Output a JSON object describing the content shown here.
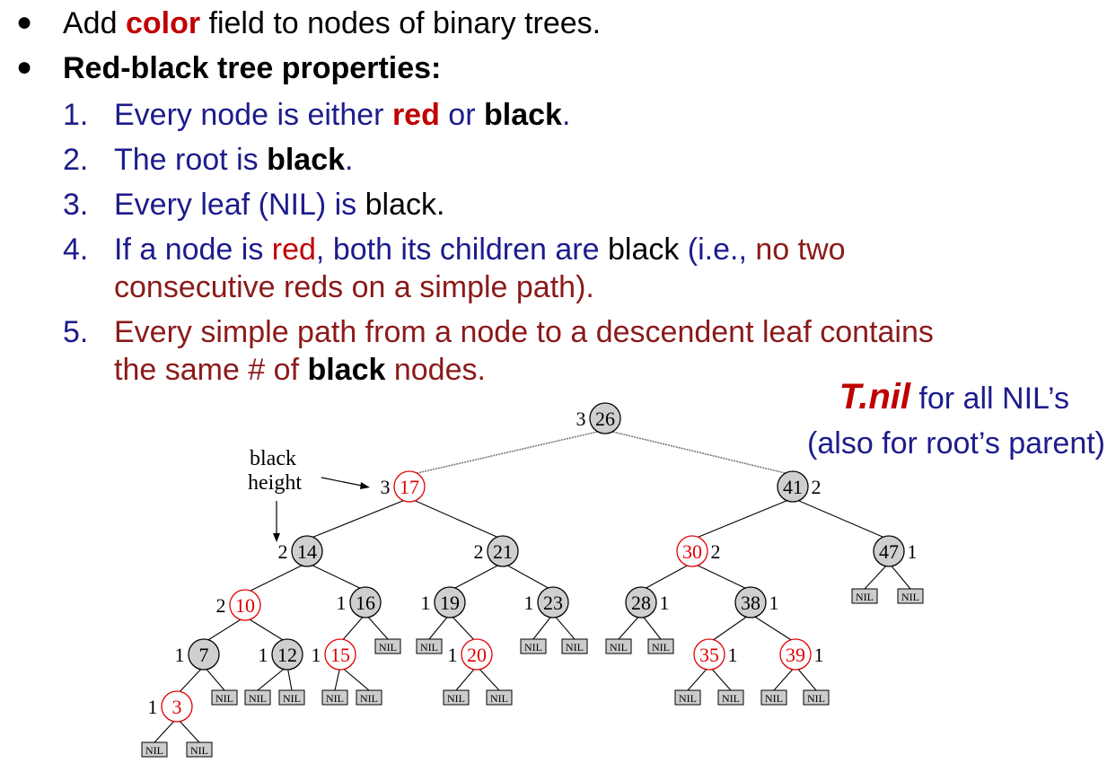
{
  "bullets": [
    {
      "pre": "Add ",
      "hl": "color",
      "post": " field to nodes of binary trees."
    },
    {
      "text": "Red-black tree properties:"
    }
  ],
  "properties": {
    "n1": "1.",
    "n2": "2.",
    "n3": "3.",
    "n4": "4.",
    "n5": "5.",
    "p1a": "Every node is either ",
    "p1b": "red",
    "p1c": " or ",
    "p1d": "black",
    "p1e": ".",
    "p2a": "The root is ",
    "p2b": "black",
    "p2c": ".",
    "p3a": "Every leaf (NIL) is ",
    "p3b": "black.",
    "p4a": "If a node is ",
    "p4b": "red",
    "p4c": ", both its children are ",
    "p4d": "black",
    "p4e": " (i.e., ",
    "p4f": "no two",
    "p4g": "consecutive reds on a simple path).",
    "p5a": "Every simple path from a node to a descendent leaf contains",
    "p5b": "the same # of ",
    "p5c": "black",
    "p5d": " nodes."
  },
  "tnil": {
    "name": "T.nil",
    "rest": " for all NIL’s",
    "line2": "(also for root’s parent)"
  },
  "diagram": {
    "annotation_line1": "black",
    "annotation_line2": "height",
    "nil_label": "NIL",
    "nodes": [
      {
        "key": "26",
        "color": "black",
        "bh": "3"
      },
      {
        "key": "17",
        "color": "red",
        "bh": "3"
      },
      {
        "key": "41",
        "color": "black",
        "bh": "2"
      },
      {
        "key": "14",
        "color": "black",
        "bh": "2"
      },
      {
        "key": "21",
        "color": "black",
        "bh": "2"
      },
      {
        "key": "30",
        "color": "red",
        "bh": "2"
      },
      {
        "key": "47",
        "color": "black",
        "bh": "1"
      },
      {
        "key": "10",
        "color": "red",
        "bh": "2"
      },
      {
        "key": "16",
        "color": "black",
        "bh": "1"
      },
      {
        "key": "19",
        "color": "black",
        "bh": "1"
      },
      {
        "key": "23",
        "color": "black",
        "bh": "1"
      },
      {
        "key": "28",
        "color": "black",
        "bh": "1"
      },
      {
        "key": "38",
        "color": "black",
        "bh": "1"
      },
      {
        "key": "7",
        "color": "black",
        "bh": "1"
      },
      {
        "key": "12",
        "color": "black",
        "bh": "1"
      },
      {
        "key": "15",
        "color": "red",
        "bh": "1"
      },
      {
        "key": "20",
        "color": "red",
        "bh": "1"
      },
      {
        "key": "35",
        "color": "red",
        "bh": "1"
      },
      {
        "key": "39",
        "color": "red",
        "bh": "1"
      },
      {
        "key": "3",
        "color": "red",
        "bh": "1"
      }
    ]
  }
}
